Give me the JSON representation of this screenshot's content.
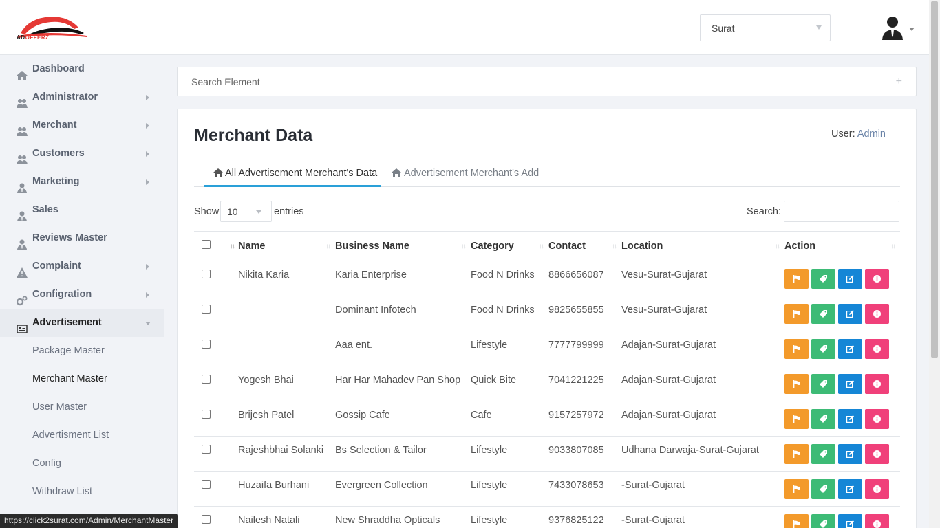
{
  "brand": {
    "logo_text_dark": "AD",
    "logo_text_red": "OFFERZ"
  },
  "header": {
    "city_value": "Surat"
  },
  "search_panel": {
    "placeholder": "Search Element",
    "plus": "+"
  },
  "sidebar": {
    "items": [
      {
        "label": "Dashboard",
        "icon": "home-icon",
        "arrow": false
      },
      {
        "label": "Administrator",
        "icon": "users-icon",
        "arrow": true
      },
      {
        "label": "Merchant",
        "icon": "users-icon",
        "arrow": true
      },
      {
        "label": "Customers",
        "icon": "users-icon",
        "arrow": true
      },
      {
        "label": "Marketing",
        "icon": "user-tie-icon",
        "arrow": true
      },
      {
        "label": "Sales",
        "icon": "user-tie-icon",
        "arrow": false
      },
      {
        "label": "Reviews Master",
        "icon": "user-tie-icon",
        "arrow": false
      },
      {
        "label": "Complaint",
        "icon": "warning-icon",
        "arrow": true
      },
      {
        "label": "Configration",
        "icon": "cogs-icon",
        "arrow": true
      },
      {
        "label": "Advertisement",
        "icon": "newspaper-icon",
        "arrow": true
      }
    ],
    "sub_items": [
      "Package Master",
      "Merchant Master",
      "User Master",
      "Advertisment List",
      "Config",
      "Withdraw List"
    ]
  },
  "status_url": "https://click2surat.com/Admin/MerchantMaster",
  "main": {
    "title": "Merchant Data",
    "user_prefix": "User:",
    "user_name": "Admin",
    "tabs": [
      "All Advertisement Merchant's Data",
      "Advertisement Merchant's Add"
    ],
    "show_label": "Show",
    "entries_value": "10",
    "entries_label": "entries",
    "search_label": "Search:"
  },
  "table": {
    "headers": [
      "Name",
      "Business Name",
      "Category",
      "Contact",
      "Location",
      "Action"
    ],
    "rows": [
      {
        "name": "Nikita Karia",
        "business": "Karia Enterprise",
        "category": "Food N Drinks",
        "contact": "8866656087",
        "location": "Vesu-Surat-Gujarat"
      },
      {
        "name": "",
        "business": "Dominant Infotech",
        "category": "Food N Drinks",
        "contact": "9825655855",
        "location": "Vesu-Surat-Gujarat"
      },
      {
        "name": "",
        "business": "Aaa ent.",
        "category": "Lifestyle",
        "contact": "7777799999",
        "location": "Adajan-Surat-Gujarat"
      },
      {
        "name": "Yogesh Bhai",
        "business": "Har Har Mahadev Pan Shop",
        "category": "Quick Bite",
        "contact": "7041221225",
        "location": "Adajan-Surat-Gujarat"
      },
      {
        "name": "Brijesh Patel",
        "business": "Gossip Cafe",
        "category": "Cafe",
        "contact": "9157257972",
        "location": "Adajan-Surat-Gujarat"
      },
      {
        "name": "Rajeshbhai Solanki",
        "business": "Bs Selection & Tailor",
        "category": "Lifestyle",
        "contact": "9033807085",
        "location": "Udhana Darwaja-Surat-Gujarat"
      },
      {
        "name": "Huzaifa Burhani",
        "business": "Evergreen Collection",
        "category": "Lifestyle",
        "contact": "7433078653",
        "location": "-Surat-Gujarat"
      },
      {
        "name": "Nailesh Natali",
        "business": "New Shraddha Opticals",
        "category": "Lifestyle",
        "contact": "9376825122",
        "location": "-Surat-Gujarat"
      }
    ]
  },
  "colors": {
    "accent": "#2aa0d8",
    "btn_orange": "#f39a2b",
    "btn_green": "#3dbb76",
    "btn_blue": "#1586d6",
    "btn_pink": "#f0407a"
  }
}
